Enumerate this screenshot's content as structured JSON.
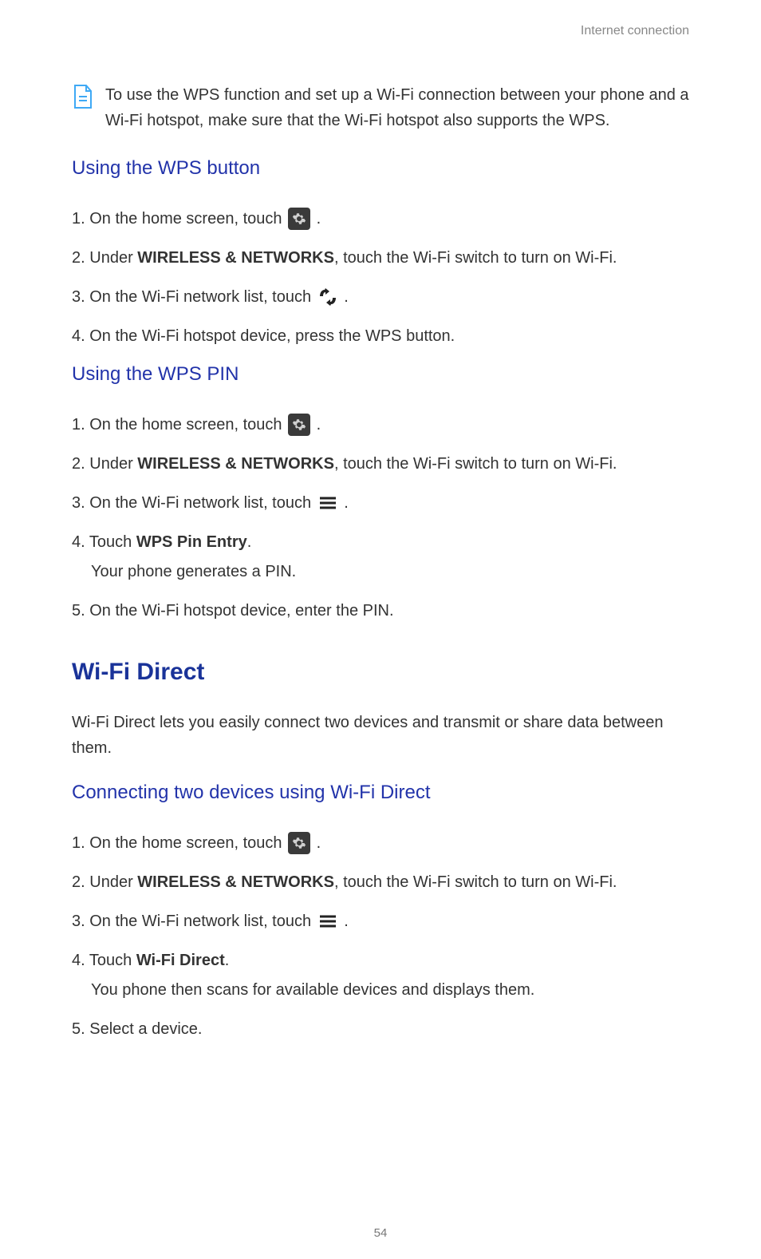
{
  "header": {
    "breadcrumb": "Internet connection"
  },
  "note": {
    "text": "To use the WPS function and set up a Wi-Fi connection between your phone and a Wi-Fi hotspot, make sure that the Wi-Fi hotspot also supports the WPS."
  },
  "subheading1": "Using the WPS button",
  "steps_wps_button": {
    "s1": {
      "prefix": "1. ",
      "text_before": "On the home screen, touch ",
      "text_after": " ."
    },
    "s2": {
      "prefix": "2. ",
      "text_before": "Under ",
      "bold": "WIRELESS & NETWORKS",
      "text_after": ", touch the Wi-Fi switch to turn on Wi-Fi."
    },
    "s3": {
      "prefix": "3. ",
      "text_before": "On the Wi-Fi network list, touch ",
      "text_after": " ."
    },
    "s4": {
      "prefix": "4. ",
      "text": "On the Wi-Fi hotspot device, press the WPS button."
    }
  },
  "subheading2": "Using the WPS PIN",
  "steps_wps_pin": {
    "s1": {
      "prefix": "1. ",
      "text_before": "On the home screen, touch ",
      "text_after": " ."
    },
    "s2": {
      "prefix": "2. ",
      "text_before": "Under ",
      "bold": "WIRELESS & NETWORKS",
      "text_after": ", touch the Wi-Fi switch to turn on Wi-Fi."
    },
    "s3": {
      "prefix": "3. ",
      "text_before": "On the Wi-Fi network list, touch ",
      "text_after": " ."
    },
    "s4": {
      "prefix": "4. ",
      "text_before": "Touch ",
      "bold": "WPS Pin Entry",
      "text_after": ".",
      "sub": "Your phone generates a PIN."
    },
    "s5": {
      "prefix": "5. ",
      "text": "On the Wi-Fi hotspot device, enter the PIN."
    }
  },
  "section_title": "Wi-Fi Direct",
  "section_intro": "Wi-Fi Direct lets you easily connect two devices and transmit or share data between them.",
  "subheading3": "Connecting two devices using Wi-Fi Direct",
  "steps_wifi_direct": {
    "s1": {
      "prefix": "1. ",
      "text_before": "On the home screen, touch ",
      "text_after": " ."
    },
    "s2": {
      "prefix": "2. ",
      "text_before": "Under ",
      "bold": "WIRELESS & NETWORKS",
      "text_after": ", touch the Wi-Fi switch to turn on Wi-Fi."
    },
    "s3": {
      "prefix": "3. ",
      "text_before": "On the Wi-Fi network list, touch ",
      "text_after": " ."
    },
    "s4": {
      "prefix": "4. ",
      "text_before": "Touch ",
      "bold": "Wi-Fi Direct",
      "text_after": ".",
      "sub": "You phone then scans for available devices and displays them."
    },
    "s5": {
      "prefix": "5. ",
      "text": "Select a device."
    }
  },
  "page_number": "54"
}
